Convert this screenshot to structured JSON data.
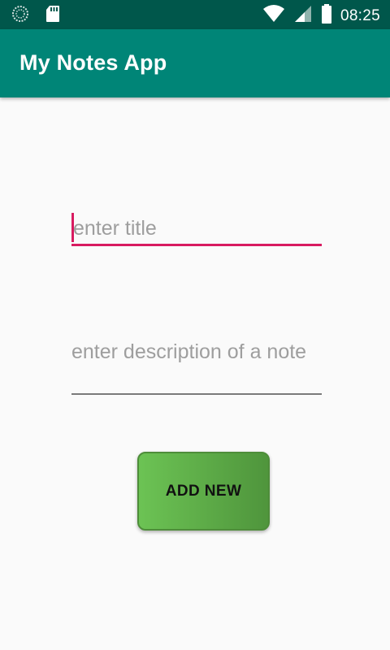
{
  "status_bar": {
    "time": "08:25",
    "icons": [
      "sync-icon",
      "sd-card-icon",
      "wifi-icon",
      "signal-icon",
      "battery-icon"
    ],
    "colors": {
      "background": "#00574b"
    }
  },
  "app_bar": {
    "title": "My Notes App",
    "colors": {
      "background": "#008577"
    }
  },
  "form": {
    "title_field": {
      "value": "",
      "placeholder": "enter title",
      "focused": true,
      "accent_color": "#d81b60"
    },
    "description_field": {
      "value": "",
      "placeholder": "enter description of a note"
    },
    "add_button": {
      "label": "ADD NEW",
      "color": "#5fae48"
    }
  }
}
